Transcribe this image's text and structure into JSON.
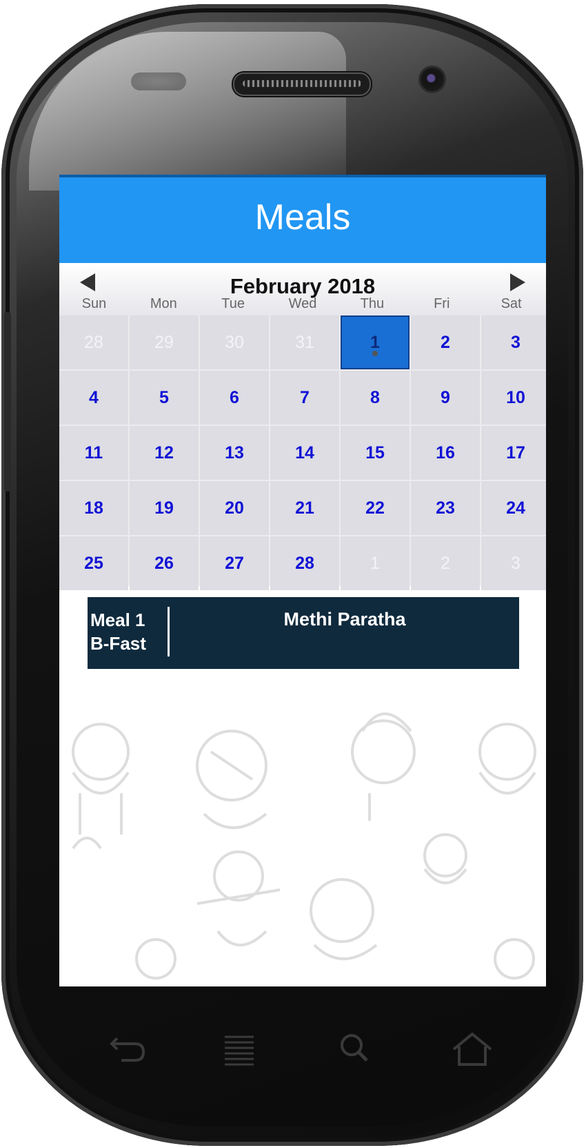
{
  "app": {
    "title": "Meals"
  },
  "calendar": {
    "month_label": "February 2018",
    "weekdays": [
      "Sun",
      "Mon",
      "Tue",
      "Wed",
      "Thu",
      "Fri",
      "Sat"
    ],
    "days": [
      {
        "label": "28",
        "muted": true
      },
      {
        "label": "29",
        "muted": true
      },
      {
        "label": "30",
        "muted": true
      },
      {
        "label": "31",
        "muted": true
      },
      {
        "label": "1",
        "muted": false,
        "selected": true,
        "has_event": true
      },
      {
        "label": "2",
        "muted": false
      },
      {
        "label": "3",
        "muted": false
      },
      {
        "label": "4",
        "muted": false
      },
      {
        "label": "5",
        "muted": false
      },
      {
        "label": "6",
        "muted": false
      },
      {
        "label": "7",
        "muted": false
      },
      {
        "label": "8",
        "muted": false
      },
      {
        "label": "9",
        "muted": false
      },
      {
        "label": "10",
        "muted": false
      },
      {
        "label": "11",
        "muted": false
      },
      {
        "label": "12",
        "muted": false
      },
      {
        "label": "13",
        "muted": false
      },
      {
        "label": "14",
        "muted": false
      },
      {
        "label": "15",
        "muted": false
      },
      {
        "label": "16",
        "muted": false
      },
      {
        "label": "17",
        "muted": false
      },
      {
        "label": "18",
        "muted": false
      },
      {
        "label": "19",
        "muted": false
      },
      {
        "label": "20",
        "muted": false
      },
      {
        "label": "21",
        "muted": false
      },
      {
        "label": "22",
        "muted": false
      },
      {
        "label": "23",
        "muted": false
      },
      {
        "label": "24",
        "muted": false
      },
      {
        "label": "25",
        "muted": false
      },
      {
        "label": "26",
        "muted": false
      },
      {
        "label": "27",
        "muted": false
      },
      {
        "label": "28",
        "muted": false
      },
      {
        "label": "1",
        "muted": true
      },
      {
        "label": "2",
        "muted": true
      },
      {
        "label": "3",
        "muted": true
      }
    ],
    "prev_icon": "left-arrow-icon",
    "next_icon": "right-arrow-icon"
  },
  "meal": {
    "number": "Meal 1",
    "type": "B-Fast",
    "name": "Methi Paratha"
  },
  "colors": {
    "appbar": "#2196f3",
    "day_text": "#1212d6",
    "selected_day": "#1a6fd4",
    "meal_bg": "#0f2a3d"
  },
  "system_keys": [
    "back-icon",
    "menu-icon",
    "search-icon",
    "home-icon"
  ]
}
